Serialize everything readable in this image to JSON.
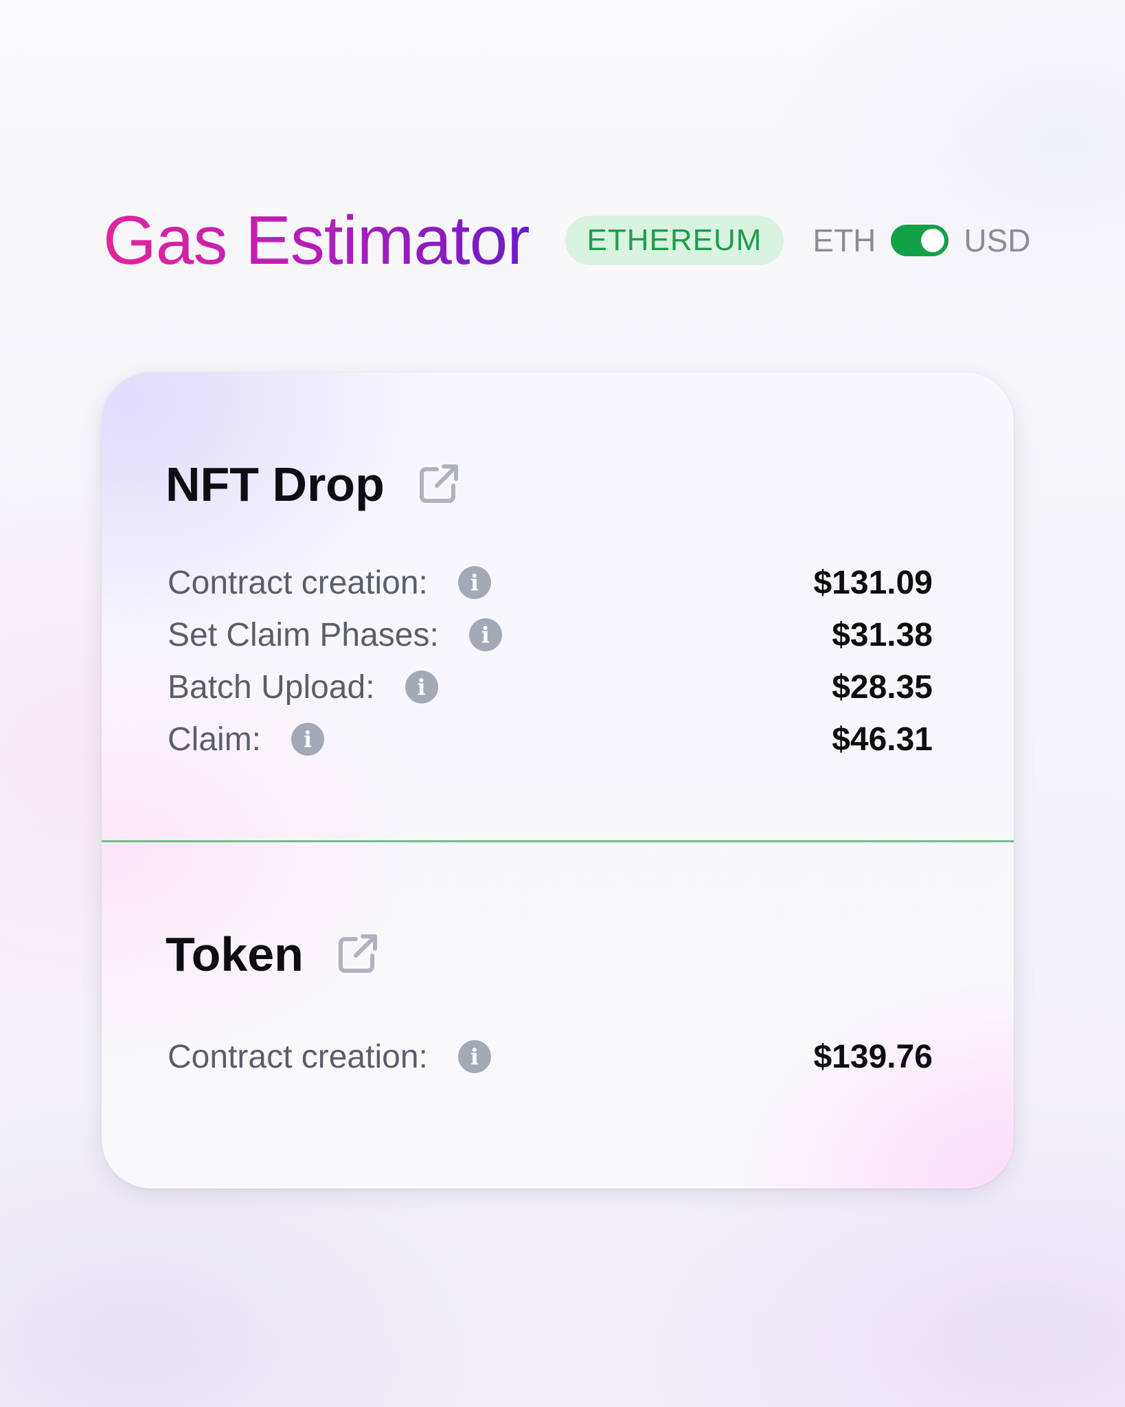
{
  "header": {
    "title": "Gas Estimator",
    "network_badge": "ETHEREUM",
    "currency_left": "ETH",
    "currency_right": "USD",
    "currency_selected": "USD"
  },
  "sections": [
    {
      "title": "NFT Drop",
      "icon": "external-link-icon",
      "rows": [
        {
          "label": "Contract creation:",
          "value": "$131.09"
        },
        {
          "label": "Set Claim Phases:",
          "value": "$31.38"
        },
        {
          "label": "Batch Upload:",
          "value": "$28.35"
        },
        {
          "label": "Claim:",
          "value": "$46.31"
        }
      ]
    },
    {
      "title": "Token",
      "icon": "external-link-icon",
      "rows": [
        {
          "label": "Contract creation:",
          "value": "$139.76"
        }
      ]
    }
  ],
  "colors": {
    "title_gradient_start": "#e3259a",
    "title_gradient_end": "#6b1cc6",
    "badge_bg": "#d8f3e0",
    "badge_text": "#1e9c49",
    "toggle_on": "#12a146",
    "divider": "#68c28b"
  },
  "icons": {
    "info": "info-icon",
    "external_link": "external-link-icon"
  }
}
